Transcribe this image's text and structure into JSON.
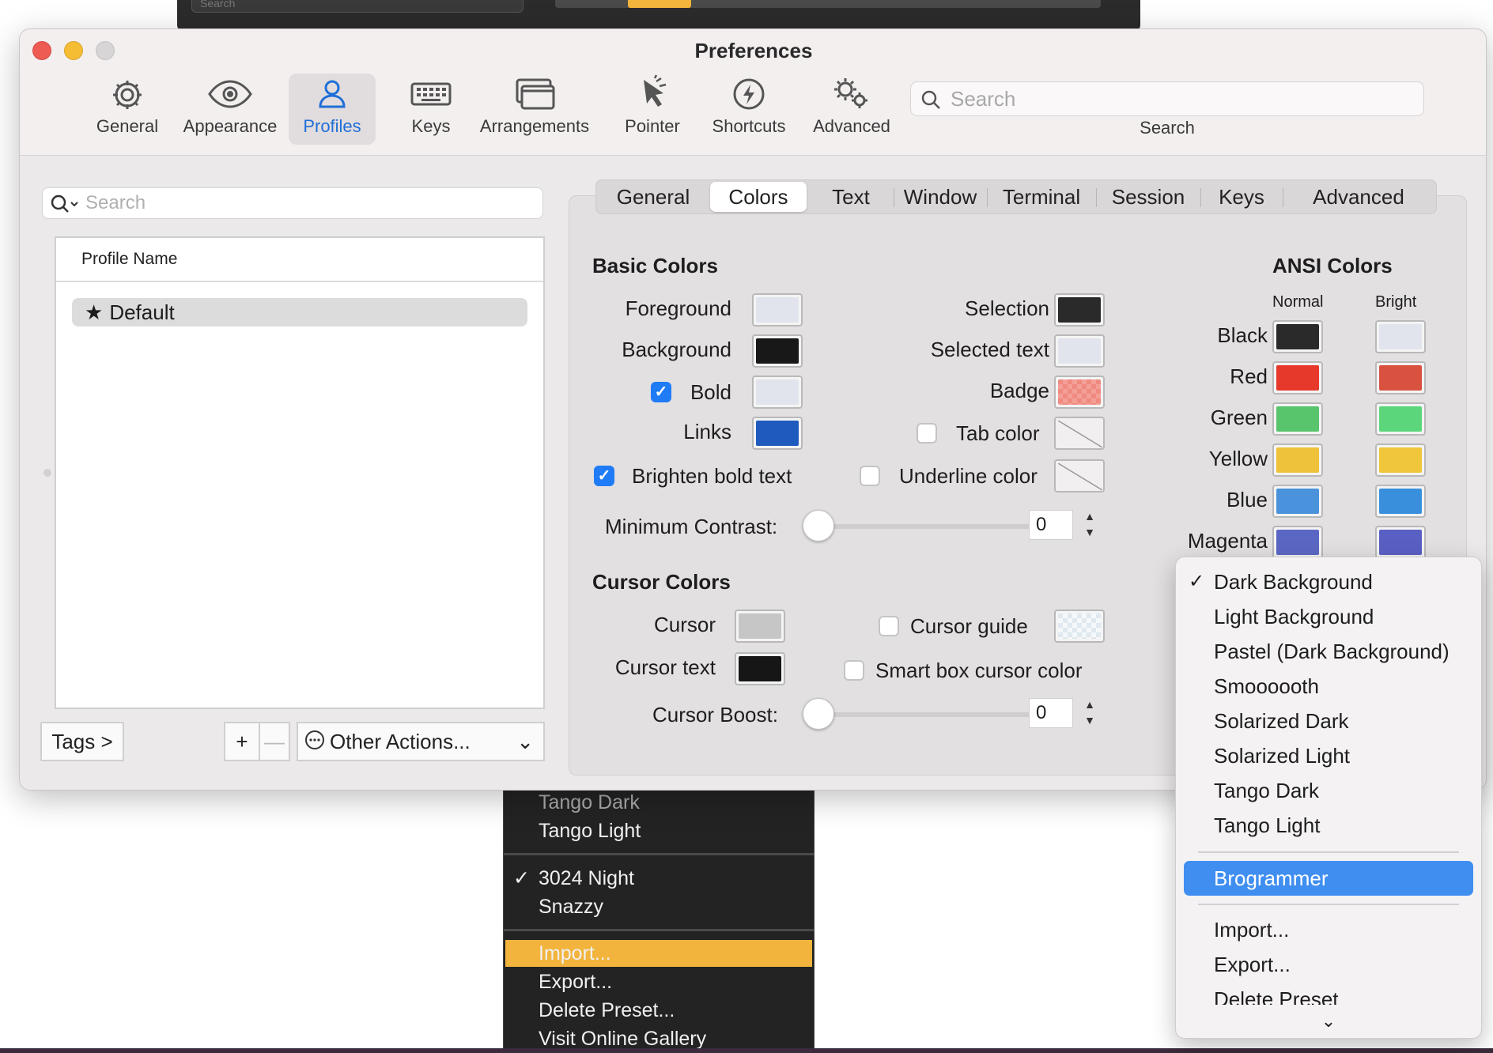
{
  "background_window": {
    "search_placeholder": "Search"
  },
  "window": {
    "title": "Preferences",
    "toolbar": {
      "items": [
        {
          "label": "General",
          "icon": "gear-icon"
        },
        {
          "label": "Appearance",
          "icon": "eye-icon"
        },
        {
          "label": "Profiles",
          "icon": "person-icon"
        },
        {
          "label": "Keys",
          "icon": "keyboard-icon"
        },
        {
          "label": "Arrangements",
          "icon": "windows-icon"
        },
        {
          "label": "Pointer",
          "icon": "pointer-icon"
        },
        {
          "label": "Shortcuts",
          "icon": "bolt-icon"
        },
        {
          "label": "Advanced",
          "icon": "gears-icon"
        }
      ],
      "active": "Profiles",
      "search_placeholder": "Search",
      "search_label": "Search"
    }
  },
  "profiles": {
    "search_placeholder": "Search",
    "column_header": "Profile Name",
    "rows": [
      {
        "name": "Default",
        "icon": "star-icon"
      }
    ],
    "tags_label": "Tags >",
    "add_label": "+",
    "remove_label": "—",
    "other_actions_label": "Other Actions..."
  },
  "tabs": {
    "items": [
      "General",
      "Colors",
      "Text",
      "Window",
      "Terminal",
      "Session",
      "Keys",
      "Advanced"
    ],
    "active": "Colors"
  },
  "basic_colors": {
    "title": "Basic Colors",
    "foreground": {
      "label": "Foreground",
      "color": "#e1e4ec"
    },
    "background": {
      "label": "Background",
      "color": "#181818"
    },
    "bold": {
      "label": "Bold",
      "checked": true,
      "color": "#e1e4ec"
    },
    "links": {
      "label": "Links",
      "color": "#1f5bbf"
    },
    "brighten_bold": {
      "label": "Brighten bold text",
      "checked": true
    },
    "selection": {
      "label": "Selection",
      "color": "#2a2a2a"
    },
    "selected_text": {
      "label": "Selected text",
      "color": "#e1e4ec"
    },
    "badge": {
      "label": "Badge",
      "color": "#f08a80"
    },
    "tab_color": {
      "label": "Tab color",
      "checked": false
    },
    "underline_color": {
      "label": "Underline color",
      "checked": false
    },
    "min_contrast": {
      "label": "Minimum Contrast:",
      "value": "0",
      "level": 0
    }
  },
  "cursor_colors": {
    "title": "Cursor Colors",
    "cursor": {
      "label": "Cursor",
      "color": "#c6c6c6"
    },
    "cursor_text": {
      "label": "Cursor text",
      "color": "#161616"
    },
    "cursor_guide": {
      "label": "Cursor guide",
      "checked": false,
      "color": "#dfe9ef"
    },
    "smart_box": {
      "label": "Smart box cursor color",
      "checked": false
    },
    "boost": {
      "label": "Cursor Boost:",
      "value": "0",
      "level": 0
    }
  },
  "ansi_colors": {
    "title": "ANSI Colors",
    "col_normal": "Normal",
    "col_bright": "Bright",
    "rows": [
      {
        "label": "Black",
        "normal": "#2a2a2a",
        "bright": "#e1e4ec"
      },
      {
        "label": "Red",
        "normal": "#e6392b",
        "bright": "#d9513f"
      },
      {
        "label": "Green",
        "normal": "#58c46c",
        "bright": "#5bd67a"
      },
      {
        "label": "Yellow",
        "normal": "#eec33b",
        "bright": "#f0c63b"
      },
      {
        "label": "Blue",
        "normal": "#4a93dc",
        "bright": "#3a8fdd"
      },
      {
        "label": "Magenta",
        "normal": "#5b67c4",
        "bright": "#5a5fc4"
      }
    ]
  },
  "preset_menu": {
    "items_top": [
      {
        "label": "Dark Background",
        "checked": true
      },
      {
        "label": "Light Background"
      },
      {
        "label": "Pastel (Dark Background)"
      },
      {
        "label": "Smoooooth"
      },
      {
        "label": "Solarized Dark"
      },
      {
        "label": "Solarized Light"
      },
      {
        "label": "Tango Dark"
      },
      {
        "label": "Tango Light"
      }
    ],
    "highlighted": "Brogrammer",
    "items_bottom": [
      "Import...",
      "Export...",
      "Delete Preset"
    ]
  },
  "dark_menu": {
    "items_a": [
      "Tango Dark",
      "Tango Light"
    ],
    "items_b": [
      {
        "label": "3024 Night",
        "checked": true
      },
      {
        "label": "Snazzy"
      }
    ],
    "highlighted": "Import...",
    "items_c": [
      "Export...",
      "Delete Preset...",
      "Visit Online Gallery"
    ]
  }
}
